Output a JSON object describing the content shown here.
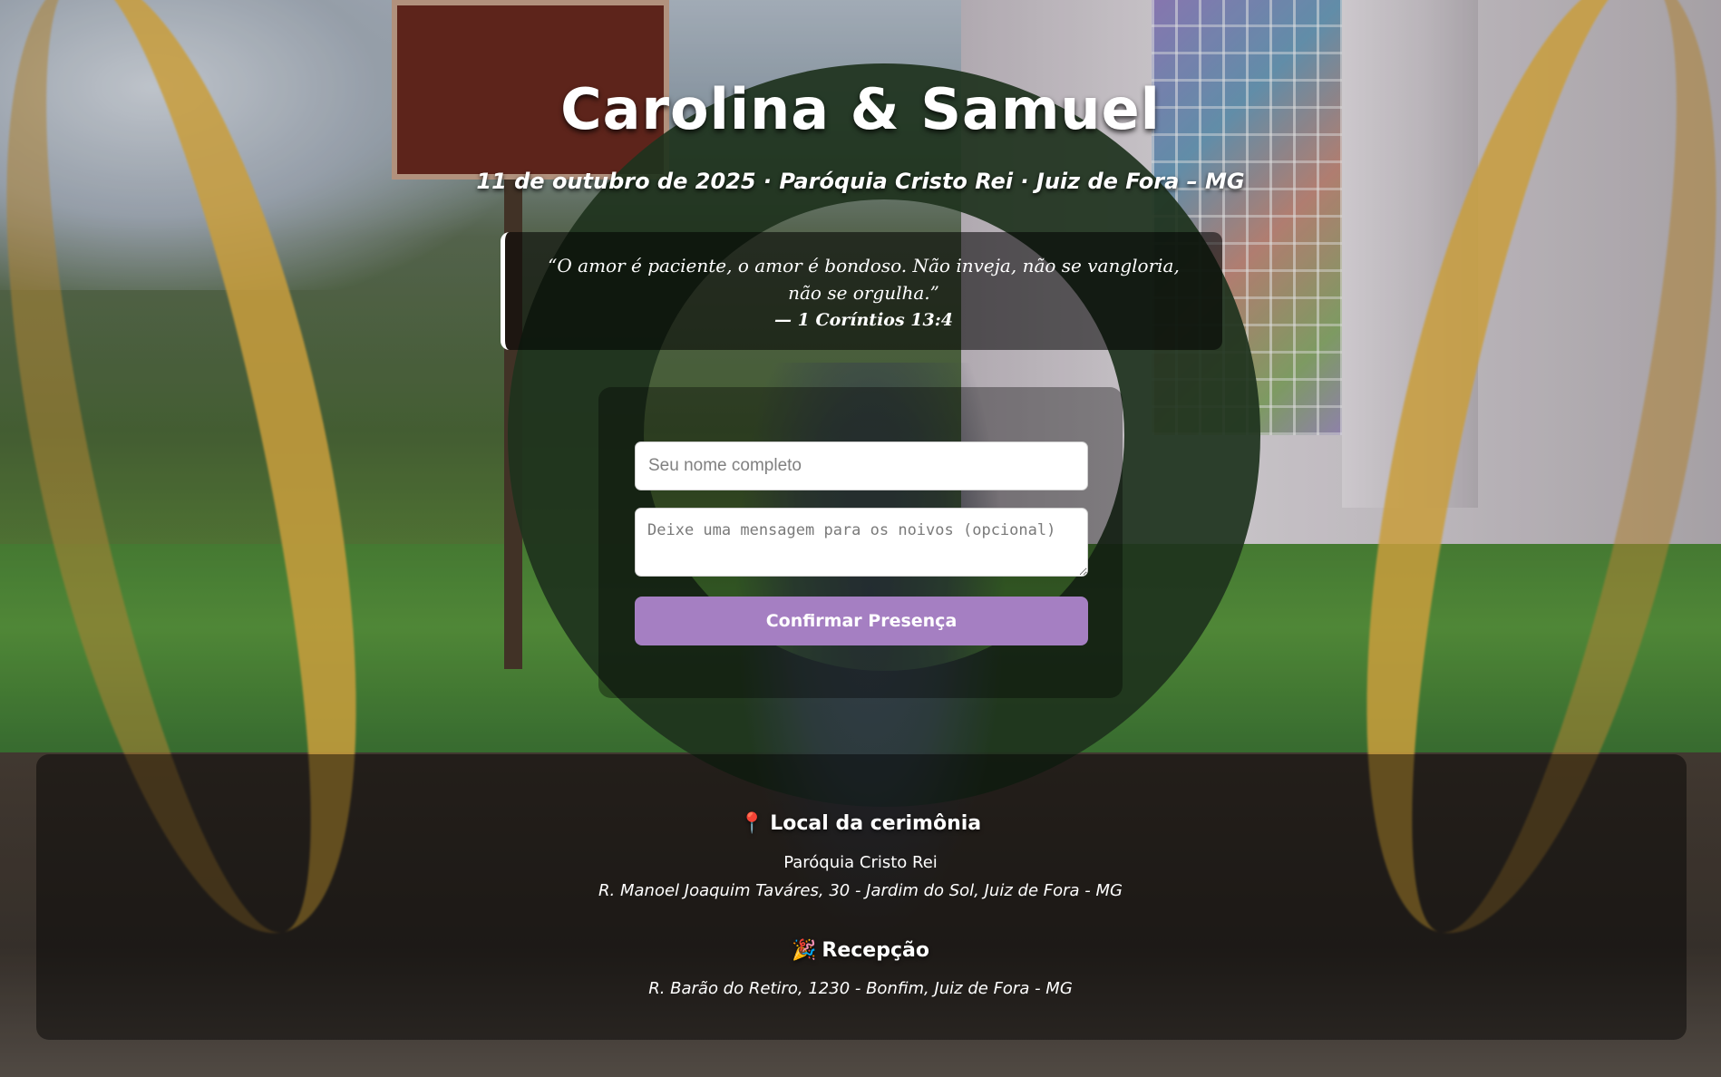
{
  "header": {
    "title": "Carolina & Samuel",
    "subtitle": "11 de outubro de 2025 · Paróquia Cristo Rei · Juiz de Fora – MG"
  },
  "verse": {
    "text": "“O amor é paciente, o amor é bondoso. Não inveja, não se vangloria, não se orgulha.”",
    "reference": "— 1 Coríntios 13:4"
  },
  "rsvp_form": {
    "name_placeholder": "Seu nome completo",
    "message_placeholder": "Deixe uma mensagem para os noivos (opcional)",
    "submit_label": "Confirmar Presença",
    "accent_color": "#a57fc2"
  },
  "details": {
    "ceremony": {
      "icon": "pin-icon",
      "icon_glyph": "📍",
      "heading": "Local da cerimônia",
      "place": "Paróquia Cristo Rei",
      "address": "R. Manoel Joaquim Taváres, 30 - Jardim do Sol, Juiz de Fora - MG"
    },
    "reception": {
      "icon": "party-popper-icon",
      "icon_glyph": "🎉",
      "heading": "Recepção",
      "address": "R. Barão do Retiro, 1230 - Bonfim, Juiz de Fora - MG"
    }
  }
}
